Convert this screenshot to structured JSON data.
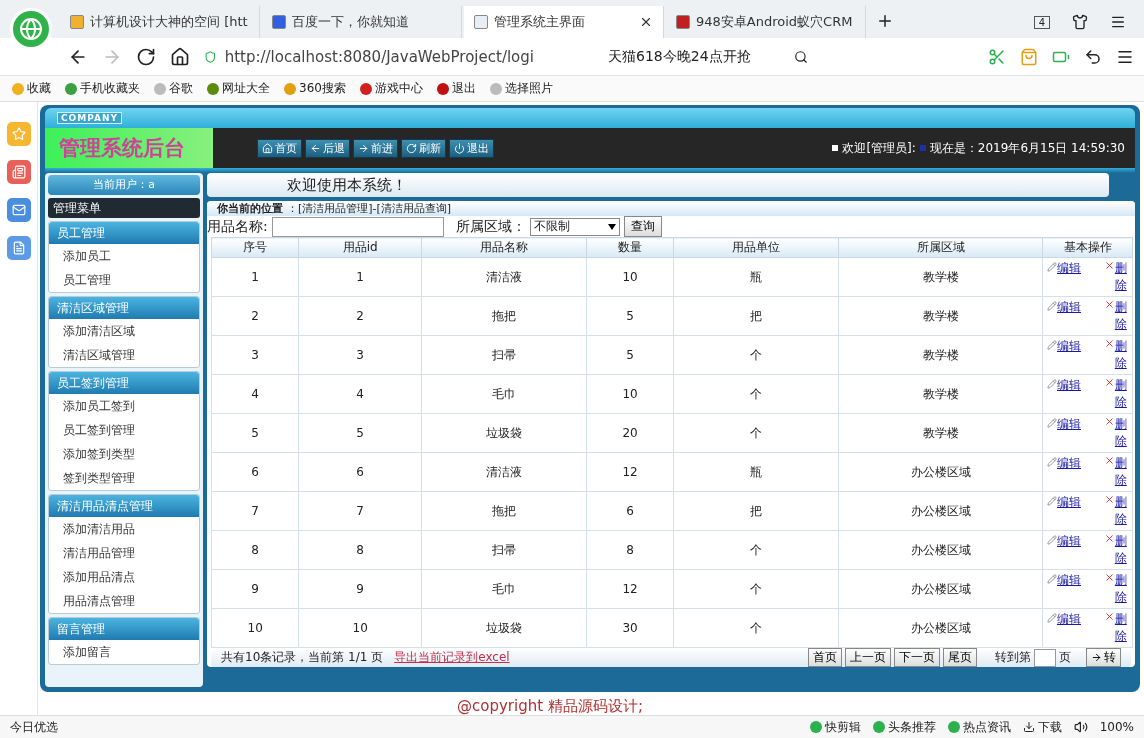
{
  "browser": {
    "tabs": [
      {
        "title": "计算机设计大神的空间 [htt",
        "selected": false
      },
      {
        "title": "百度一下，你就知道",
        "selected": false
      },
      {
        "title": "管理系统主界面",
        "selected": true
      },
      {
        "title": "948安卓Android蚁穴CRM",
        "selected": false
      }
    ],
    "tab_count": "4",
    "address": "http://localhost:8080/JavaWebProject/logi",
    "search": "天猫618今晚24点开抢",
    "bookmarks": [
      "收藏",
      "手机收藏夹",
      "谷歌",
      "网址大全",
      "360搜索",
      "游戏中心",
      "退出",
      "选择照片"
    ],
    "status_left": "今日优选",
    "status_items": [
      "快剪辑",
      "头条推荐",
      "热点资讯",
      "下载"
    ],
    "zoom": "100%"
  },
  "header": {
    "company": "COMPANY",
    "title": "管理系统后台",
    "nav": [
      "首页",
      "后退",
      "前进",
      "刷新",
      "退出"
    ],
    "greeting": "欢迎[管理员]:",
    "time": "现在是：2019年6月15日 14:59:30"
  },
  "current_user": "当前用户：a",
  "menu_title": "管理菜单",
  "welcome": "欢迎使用本系统！",
  "menu": [
    {
      "title": "员工管理",
      "items": [
        "添加员工",
        "员工管理"
      ]
    },
    {
      "title": "清洁区域管理",
      "items": [
        "添加清洁区域",
        "清洁区域管理"
      ]
    },
    {
      "title": "员工签到管理",
      "items": [
        "添加员工签到",
        "员工签到管理",
        "添加签到类型",
        "签到类型管理"
      ]
    },
    {
      "title": "清洁用品清点管理",
      "items": [
        "添加清洁用品",
        "清洁用品管理",
        "添加用品清点",
        "用品清点管理"
      ]
    },
    {
      "title": "留言管理",
      "items": [
        "添加留言"
      ]
    }
  ],
  "location": {
    "label": "你当前的位置",
    "path": "：[清洁用品管理]-[清洁用品查询]"
  },
  "search_form": {
    "name_label": "用品名称:",
    "area_label": "所属区域：",
    "area_value": "不限制",
    "button": "查询"
  },
  "table": {
    "columns": [
      "序号",
      "用品id",
      "用品名称",
      "数量",
      "用品单位",
      "所属区域",
      "基本操作"
    ],
    "rows": [
      {
        "cells": [
          "1",
          "1",
          "清洁液",
          "10",
          "瓶",
          "教学楼"
        ],
        "edit": "编辑",
        "delete": "删除"
      },
      {
        "cells": [
          "2",
          "2",
          "拖把",
          "5",
          "把",
          "教学楼"
        ],
        "edit": "编辑",
        "delete": "删除"
      },
      {
        "cells": [
          "3",
          "3",
          "扫帚",
          "5",
          "个",
          "教学楼"
        ],
        "edit": "编辑",
        "delete": "删除"
      },
      {
        "cells": [
          "4",
          "4",
          "毛巾",
          "10",
          "个",
          "教学楼"
        ],
        "edit": "编辑",
        "delete": "删除"
      },
      {
        "cells": [
          "5",
          "5",
          "垃圾袋",
          "20",
          "个",
          "教学楼"
        ],
        "edit": "编辑",
        "delete": "删除"
      },
      {
        "cells": [
          "6",
          "6",
          "清洁液",
          "12",
          "瓶",
          "办公楼区域"
        ],
        "edit": "编辑",
        "delete": "删除"
      },
      {
        "cells": [
          "7",
          "7",
          "拖把",
          "6",
          "把",
          "办公楼区域"
        ],
        "edit": "编辑",
        "delete": "删除"
      },
      {
        "cells": [
          "8",
          "8",
          "扫帚",
          "8",
          "个",
          "办公楼区域"
        ],
        "edit": "编辑",
        "delete": "删除"
      },
      {
        "cells": [
          "9",
          "9",
          "毛巾",
          "12",
          "个",
          "办公楼区域"
        ],
        "edit": "编辑",
        "delete": "删除"
      },
      {
        "cells": [
          "10",
          "10",
          "垃圾袋",
          "30",
          "个",
          "办公楼区域"
        ],
        "edit": "编辑",
        "delete": "删除"
      }
    ]
  },
  "pager": {
    "summary": "共有10条记录，当前第 1/1 页",
    "export": "导出当前记录到excel",
    "buttons": [
      "首页",
      "上一页",
      "下一页",
      "尾页"
    ],
    "goto_label": "转到第",
    "page_unit": "页",
    "go": "转"
  },
  "copyright": "@copyright 精品源码设计;"
}
